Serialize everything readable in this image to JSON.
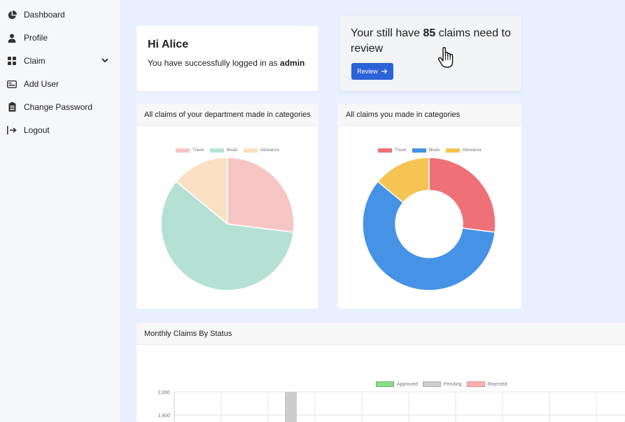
{
  "sidebar": {
    "items": [
      {
        "label": "Dashboard",
        "icon": "pie-chart-icon"
      },
      {
        "label": "Profile",
        "icon": "user-icon"
      },
      {
        "label": "Claim",
        "icon": "grid-icon"
      },
      {
        "label": "Add User",
        "icon": "id-card-icon"
      },
      {
        "label": "Change Password",
        "icon": "clipboard-icon"
      },
      {
        "label": "Logout",
        "icon": "logout-icon"
      }
    ]
  },
  "welcome": {
    "title": "Hi Alice",
    "message_prefix": "You have successfully logged in as ",
    "role": "admin"
  },
  "claims_review": {
    "prefix": "Your still have ",
    "count": "85",
    "suffix": " claims need to review",
    "button_label": "Review"
  },
  "department_chart": {
    "title": "All claims of your department made in categories",
    "chart_data": {
      "type": "pie",
      "categories": [
        "Travel",
        "Meals",
        "Allowance"
      ],
      "values": [
        27,
        59,
        14
      ],
      "colors": [
        "#f7c6c4",
        "#b5e1d4",
        "#fae1c3"
      ]
    }
  },
  "my_chart": {
    "title": "All claims you made in categories",
    "chart_data": {
      "type": "pie",
      "donut": true,
      "categories": [
        "Travel",
        "Meals",
        "Allowance"
      ],
      "values": [
        27,
        59,
        14
      ],
      "colors": [
        "#f07078",
        "#4592e6",
        "#f5c453"
      ]
    }
  },
  "monthly_chart": {
    "title": "Monthly Claims By Status",
    "chart_data": {
      "type": "bar",
      "series": [
        {
          "name": "Approved",
          "color": "#8fda8f"
        },
        {
          "name": "Pending",
          "color": "#cccccc"
        },
        {
          "name": "Rejected",
          "color": "#f7b2b2"
        }
      ],
      "y_ticks": [
        "2,000",
        "1,800"
      ]
    }
  }
}
